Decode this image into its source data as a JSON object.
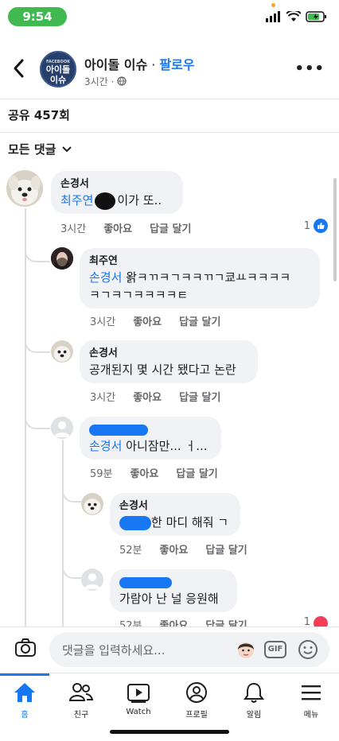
{
  "status_bar": {
    "time": "9:54"
  },
  "header": {
    "page_name": "아이돌 이슈",
    "separator": " · ",
    "follow_label": "팔로우",
    "time_ago": "3시간 · ",
    "logo_text_top": "아이돌",
    "logo_text_bottom": "이슈",
    "logo_mini": "FACEBOOK"
  },
  "shares_text": "공유 457회",
  "sort_label": "모든 댓글",
  "comments": [
    {
      "name": "손경서",
      "tag": "최주연",
      "text": "이가 또..",
      "time": "3시간",
      "like": "좋아요",
      "reply": "답글 달기",
      "reaction_count": "1"
    },
    {
      "name": "최주연",
      "tag": "손경서",
      "text": " 왉ㅋㄲㅋㄱㅋㅋㄲㄱ쿄ㅛㅋㅋㅋㅋ",
      "text2": "ㅋㄱㅋㄱㅋㅋㅋㅋㅌ",
      "time": "3시간",
      "like": "좋아요",
      "reply": "답글 달기"
    },
    {
      "name": "손경서",
      "text": "공개된지 몇 시간 됐다고 논란",
      "time": "3시간",
      "like": "좋아요",
      "reply": "답글 달기"
    },
    {
      "tag": "손경서",
      "text": " 아니잠만... ㅓ...",
      "time": "59분",
      "like": "좋아요",
      "reply": "답글 달기"
    },
    {
      "name": "손경서",
      "text": "한 마디 해줘 ㄱ",
      "time": "52분",
      "like": "좋아요",
      "reply": "답글 달기"
    },
    {
      "text": "가람아 난 널 응원해",
      "time": "52분",
      "like": "좋아요",
      "reply": "답글 달기",
      "reaction_count": "1"
    }
  ],
  "composer": {
    "placeholder": "댓글을 입력하세요...",
    "gif_label": "GIF"
  },
  "nav": [
    {
      "label": "홈",
      "icon": "home-icon"
    },
    {
      "label": "친구",
      "icon": "friends-icon"
    },
    {
      "label": "Watch",
      "icon": "watch-icon"
    },
    {
      "label": "프로필",
      "icon": "profile-icon"
    },
    {
      "label": "알림",
      "icon": "bell-icon"
    },
    {
      "label": "메뉴",
      "icon": "menu-icon"
    }
  ],
  "colors": {
    "accent": "#1877f2",
    "bubble": "#f0f2f5",
    "status_pill": "#3fb950",
    "love": "#f33e58"
  }
}
